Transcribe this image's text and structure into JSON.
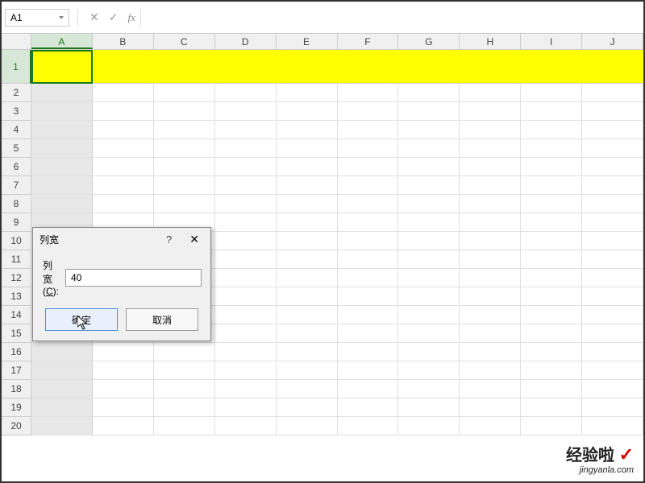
{
  "nameBox": {
    "value": "A1"
  },
  "formulaBar": {
    "fx": "fx"
  },
  "columns": [
    "A",
    "B",
    "C",
    "D",
    "E",
    "F",
    "G",
    "H",
    "I",
    "J"
  ],
  "rows": [
    "1",
    "2",
    "3",
    "4",
    "5",
    "6",
    "7",
    "8",
    "9",
    "10",
    "11",
    "12",
    "13",
    "14",
    "15",
    "16",
    "17",
    "18",
    "19",
    "20"
  ],
  "dialog": {
    "title": "列宽",
    "label_pre": "列宽(",
    "label_u": "C",
    "label_post": "):",
    "value": "40",
    "ok": "确定",
    "cancel": "取消",
    "help": "?",
    "close": "✕"
  },
  "watermark": {
    "main": "经验啦",
    "check": "✓",
    "sub": "jingyanla.com"
  }
}
